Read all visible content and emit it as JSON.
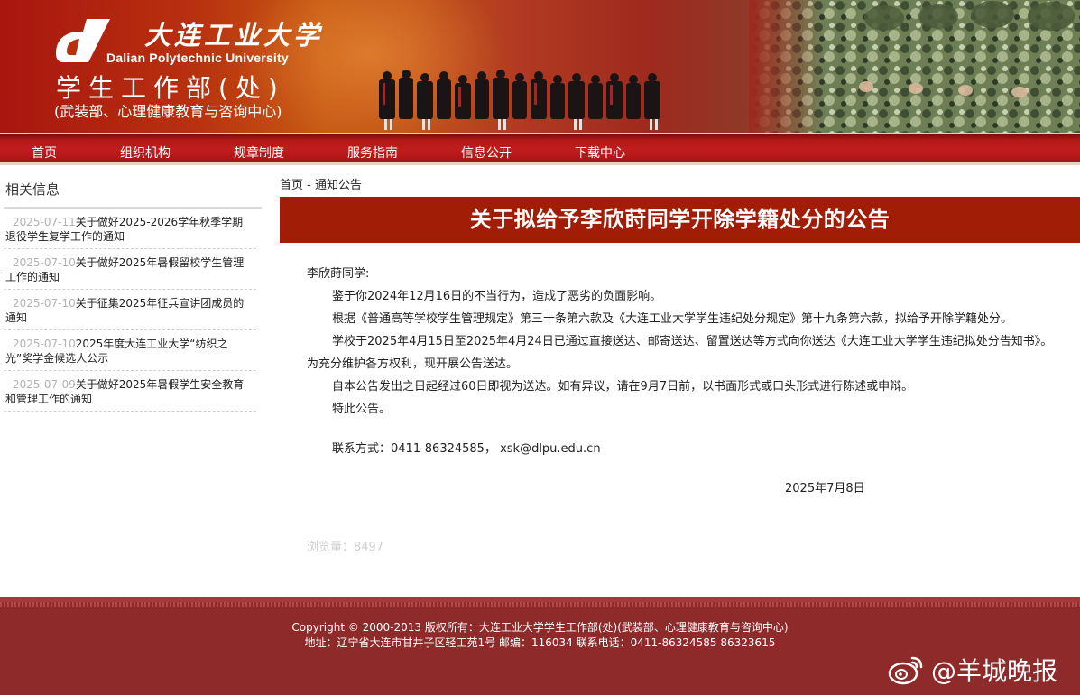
{
  "header": {
    "university_cn": "大连工业大学",
    "university_en": "Dalian Polytechnic University",
    "dept_title": "学生工作部(处)",
    "dept_subtitle": "(武装部、心理健康教育与咨询中心)"
  },
  "nav": {
    "items": [
      "首页",
      "组织机构",
      "规章制度",
      "服务指南",
      "信息公开",
      "下载中心"
    ]
  },
  "sidebar": {
    "title": "相关信息",
    "items": [
      {
        "date": "2025-07-11",
        "text": "关于做好2025-2026学年秋季学期退役学生复学工作的通知"
      },
      {
        "date": "2025-07-10",
        "text": "关于做好2025年暑假留校学生管理工作的通知"
      },
      {
        "date": "2025-07-10",
        "text": "关于征集2025年征兵宣讲团成员的通知"
      },
      {
        "date": "2025-07-10",
        "text": "2025年度大连工业大学“纺织之光”奖学金候选人公示"
      },
      {
        "date": "2025-07-09",
        "text": "关于做好2025年暑假学生安全教育和管理工作的通知"
      }
    ]
  },
  "breadcrumb": {
    "home": "首页",
    "separator": " - ",
    "current": "通知公告"
  },
  "article": {
    "title": "关于拟给予李欣莳同学开除学籍处分的公告",
    "salutation": "李欣莳同学:",
    "p1": "鉴于你2024年12月16日的不当行为，造成了恶劣的负面影响。",
    "p2": "根据《普通高等学校学生管理规定》第三十条第六款及《大连工业大学学生违纪处分规定》第十九条第六款，拟给予开除学籍处分。",
    "p3": "学校于2025年4月15日至2025年4月24日已通过直接送达、邮寄送达、留置送达等方式向你送达《大连工业大学学生违纪拟处分告知书》。为充分维护各方权利，现开展公告送达。",
    "p4": "自本公告发出之日起经过60日即视为送达。如有异议，请在9月7日前，以书面形式或口头形式进行陈述或申辩。",
    "p5": "特此公告。",
    "contact": "联系方式：0411-86324585， xsk@dlpu.edu.cn",
    "date": "2025年7月8日",
    "views": "浏览量：8497"
  },
  "footer": {
    "copyright": "Copyright © 2000-2013 版权所有：大连工业大学学生工作部(处)(武装部、心理健康教育与咨询中心)",
    "address": "地址：辽宁省大连市甘井子区轻工苑1号 邮编：116034 联系电话：0411-86324585 86323615"
  },
  "watermark": {
    "text": "@羊城晚报"
  },
  "colors": {
    "title_bar": "#a21d06",
    "nav": "#c11d1d",
    "footer": "#8f2a2a"
  }
}
